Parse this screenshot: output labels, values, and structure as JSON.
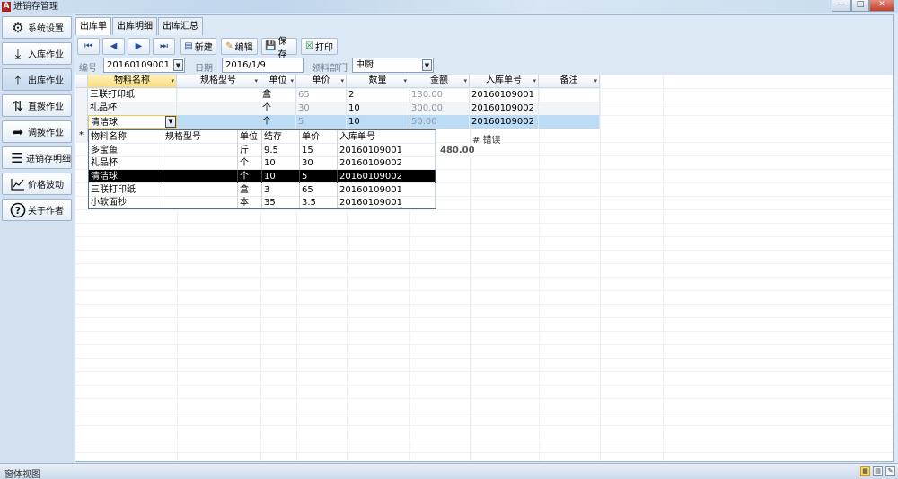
{
  "window": {
    "title": "进销存管理",
    "app_icon": "A",
    "controls": {
      "minimize": "—",
      "maximize": "□",
      "close": "✕"
    }
  },
  "sidebar": {
    "items": [
      {
        "label": "系统设置",
        "icon": "gear-icon",
        "glyph": "⚙"
      },
      {
        "label": "入库作业",
        "icon": "download-tray-icon",
        "glyph": "⤓"
      },
      {
        "label": "出库作业",
        "icon": "upload-tray-icon",
        "glyph": "⤒"
      },
      {
        "label": "直拨作业",
        "icon": "transfer-arrows-icon",
        "glyph": "⇅"
      },
      {
        "label": "调拨作业",
        "icon": "redirect-arrow-icon",
        "glyph": "➦"
      },
      {
        "label": "进销存明细",
        "icon": "list-icon",
        "glyph": "☰"
      },
      {
        "label": "价格波动",
        "icon": "line-chart-icon",
        "glyph": "📈"
      },
      {
        "label": "关于作者",
        "icon": "help-question-icon",
        "glyph": "?"
      }
    ]
  },
  "tabs": [
    "出库单",
    "出库明细",
    "出库汇总"
  ],
  "toolbar": {
    "nav": [
      "⏮",
      "◀",
      "▶",
      "⏭"
    ],
    "new_label": "新建",
    "edit_label": "编辑",
    "save_label": "保存",
    "print_label": "打印"
  },
  "form": {
    "number_label": "编号",
    "number_value": "20160109001",
    "date_label": "日期",
    "date_value": "2016/1/9",
    "dept_label": "领料部门",
    "dept_value": "中厨"
  },
  "grid": {
    "columns": [
      "物料名称",
      "规格型号",
      "单位",
      "单价",
      "数量",
      "金额",
      "入库单号",
      "备注"
    ],
    "rows": [
      {
        "name": "三联打印纸",
        "spec": "",
        "unit": "盒",
        "price": "65",
        "qty": "2",
        "amount": "130.00",
        "in_no": "20160109001",
        "note": ""
      },
      {
        "name": "礼品杯",
        "spec": "",
        "unit": "个",
        "price": "30",
        "qty": "10",
        "amount": "300.00",
        "in_no": "20160109002",
        "note": ""
      },
      {
        "name": "清洁球",
        "spec": "",
        "unit": "个",
        "price": "5",
        "qty": "10",
        "amount": "50.00",
        "in_no": "20160109002",
        "note": ""
      }
    ],
    "new_row_marker": "*",
    "total_amount": "480.00",
    "error_label": "# 错误"
  },
  "dropdown": {
    "columns": [
      "物料名称",
      "规格型号",
      "单位",
      "结存",
      "单价",
      "入库单号"
    ],
    "rows": [
      {
        "name": "多宝鱼",
        "spec": "",
        "unit": "斤",
        "stock": "9.5",
        "price": "15",
        "in_no": "20160109001"
      },
      {
        "name": "礼品杯",
        "spec": "",
        "unit": "个",
        "stock": "10",
        "price": "30",
        "in_no": "20160109002"
      },
      {
        "name": "清洁球",
        "spec": "",
        "unit": "个",
        "stock": "10",
        "price": "5",
        "in_no": "20160109002"
      },
      {
        "name": "三联打印纸",
        "spec": "",
        "unit": "盒",
        "stock": "3",
        "price": "65",
        "in_no": "20160109001"
      },
      {
        "name": "小软面抄",
        "spec": "",
        "unit": "本",
        "stock": "35",
        "price": "3.5",
        "in_no": "20160109001"
      }
    ],
    "highlighted_index": 2
  },
  "status": {
    "text": "窗体视图"
  }
}
